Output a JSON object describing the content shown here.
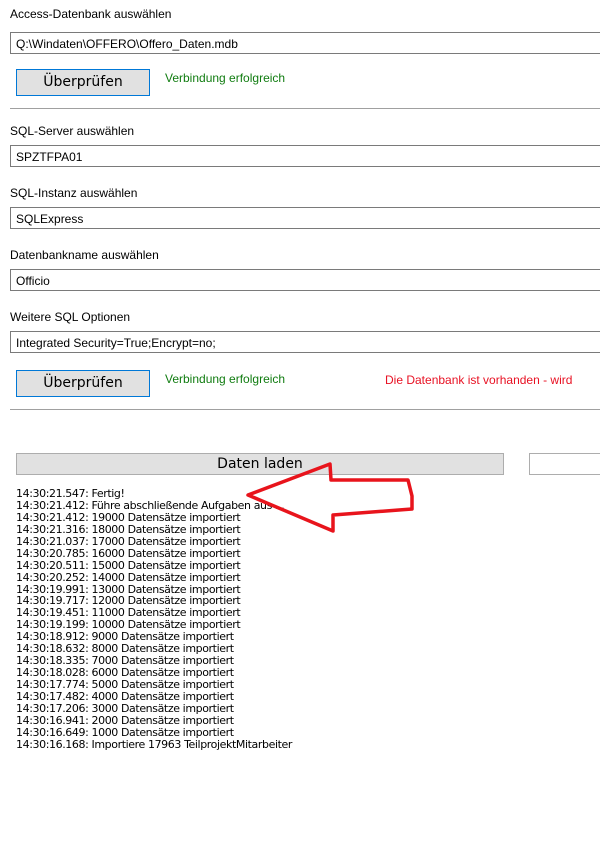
{
  "access": {
    "label": "Access-Datenbank auswählen",
    "path": "Q:\\Windaten\\OFFERO\\Offero_Daten.mdb",
    "check_button": "Überprüfen",
    "status": "Verbindung erfolgreich"
  },
  "sql": {
    "server_label": "SQL-Server auswählen",
    "server_value": "SPZTFPA01",
    "instance_label": "SQL-Instanz auswählen",
    "instance_value": "SQLExpress",
    "dbname_label": "Datenbankname auswählen",
    "dbname_value": "Officio",
    "options_label": "Weitere SQL Optionen",
    "options_value": "Integrated Security=True;Encrypt=no;",
    "check_button": "Überprüfen",
    "status": "Verbindung erfolgreich",
    "warning": "Die Datenbank ist vorhanden - wird"
  },
  "actions": {
    "load_button": "Daten laden",
    "second_button": ""
  },
  "colors": {
    "success": "#107c10",
    "error": "#e81123",
    "annotation_arrow": "#e8141c",
    "button_focus_border": "#0078d7"
  },
  "log": [
    "14:30:21.547: Fertig!",
    "14:30:21.412: Führe abschließende Aufgaben aus ...",
    "14:30:21.412: 19000 Datensätze importiert",
    "14:30:21.316: 18000 Datensätze importiert",
    "14:30:21.037: 17000 Datensätze importiert",
    "14:30:20.785: 16000 Datensätze importiert",
    "14:30:20.511: 15000 Datensätze importiert",
    "14:30:20.252: 14000 Datensätze importiert",
    "14:30:19.991: 13000 Datensätze importiert",
    "14:30:19.717: 12000 Datensätze importiert",
    "14:30:19.451: 11000 Datensätze importiert",
    "14:30:19.199: 10000 Datensätze importiert",
    "14:30:18.912: 9000 Datensätze importiert",
    "14:30:18.632: 8000 Datensätze importiert",
    "14:30:18.335: 7000 Datensätze importiert",
    "14:30:18.028: 6000 Datensätze importiert",
    "14:30:17.774: 5000 Datensätze importiert",
    "14:30:17.482: 4000 Datensätze importiert",
    "14:30:17.206: 3000 Datensätze importiert",
    "14:30:16.941: 2000 Datensätze importiert",
    "14:30:16.649: 1000 Datensätze importiert",
    "14:30:16.168: Importiere 17963 TeilprojektMitarbeiter"
  ]
}
